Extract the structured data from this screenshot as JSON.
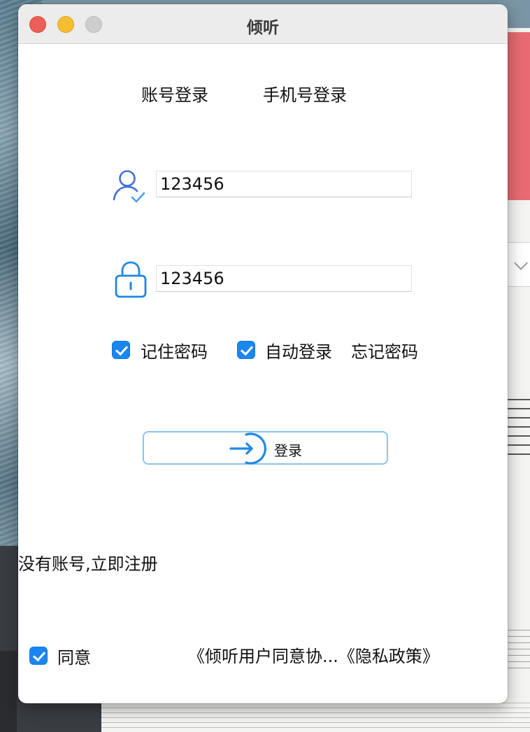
{
  "window": {
    "title": "倾听"
  },
  "tabs": {
    "account_login": "账号登录",
    "phone_login": "手机号登录"
  },
  "form": {
    "username_value": "123456",
    "password_value": "123456",
    "remember_password": {
      "label": "记住密码",
      "checked": true
    },
    "auto_login": {
      "label": "自动登录",
      "checked": true
    },
    "forgot_password": "忘记密码",
    "login_button": "登录"
  },
  "footer": {
    "register_link": "没有账号,立即注册",
    "agree": {
      "label": "同意",
      "checked": true
    },
    "policy_links": "《倾听用户同意协...《隐私政策》"
  },
  "icons": {
    "user": "user-check-icon",
    "lock": "lock-icon",
    "login": "login-arrow-icon"
  },
  "colors": {
    "accent": "#1a86f0",
    "icon_blue": "#1e88e5",
    "button_border": "#8cc3ee"
  }
}
